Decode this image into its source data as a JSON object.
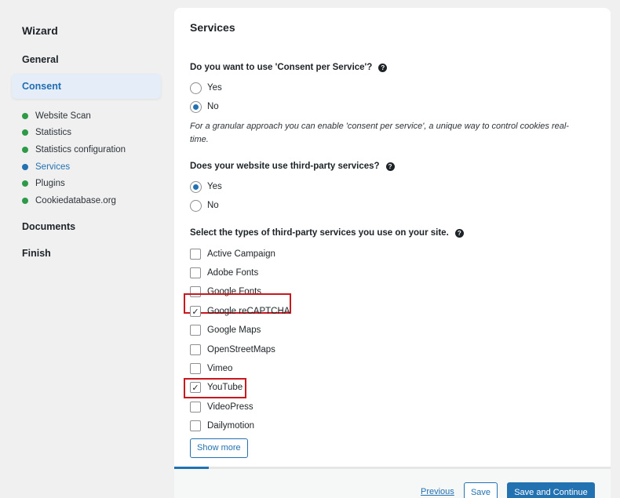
{
  "sidebar": {
    "title": "Wizard",
    "steps": {
      "general": "General",
      "consent": "Consent",
      "documents": "Documents",
      "finish": "Finish"
    },
    "substeps": [
      {
        "label": "Website Scan",
        "status": "done"
      },
      {
        "label": "Statistics",
        "status": "done"
      },
      {
        "label": "Statistics configuration",
        "status": "done"
      },
      {
        "label": "Services",
        "status": "active"
      },
      {
        "label": "Plugins",
        "status": "done"
      },
      {
        "label": "Cookiedatabase.org",
        "status": "done"
      }
    ]
  },
  "main": {
    "title": "Services",
    "q1": {
      "question": "Do you want to use 'Consent per Service'?",
      "options": [
        "Yes",
        "No"
      ],
      "selected": "No",
      "note": "For a granular approach you can enable 'consent per service', a unique way to control cookies real-time."
    },
    "q2": {
      "question": "Does your website use third-party services?",
      "options": [
        "Yes",
        "No"
      ],
      "selected": "Yes"
    },
    "q3": {
      "question": "Select the types of third-party services you use on your site.",
      "services": [
        {
          "label": "Active Campaign",
          "checked": false
        },
        {
          "label": "Adobe Fonts",
          "checked": false
        },
        {
          "label": "Google Fonts",
          "checked": false
        },
        {
          "label": "Google reCAPTCHA",
          "checked": true
        },
        {
          "label": "Google Maps",
          "checked": false
        },
        {
          "label": "OpenStreetMaps",
          "checked": false
        },
        {
          "label": "Vimeo",
          "checked": false
        },
        {
          "label": "YouTube",
          "checked": true
        },
        {
          "label": "VideoPress",
          "checked": false
        },
        {
          "label": "Dailymotion",
          "checked": false
        }
      ]
    },
    "show_more": "Show more"
  },
  "footer": {
    "previous": "Previous",
    "save": "Save",
    "save_continue": "Save and Continue"
  },
  "colors": {
    "accent": "#2271b1",
    "done": "#2e9a48",
    "highlight": "#c9181e"
  }
}
